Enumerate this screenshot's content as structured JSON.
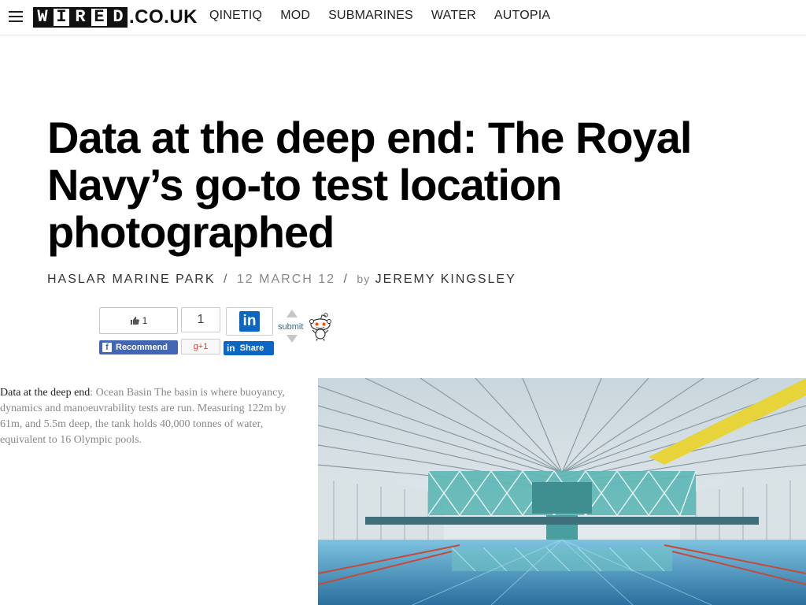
{
  "topnav": {
    "logo_letters": [
      "W",
      "I",
      "R",
      "E",
      "D"
    ],
    "logo_domain": ".CO.UK",
    "links": [
      "QINETIQ",
      "MOD",
      "SUBMARINES",
      "WATER",
      "AUTOPIA"
    ]
  },
  "article": {
    "headline": "Data at the deep end: The Royal Navy’s go-to test location photographed",
    "category": "HASLAR MARINE PARK",
    "date": "12 MARCH 12",
    "by_label": "by",
    "author": "JEREMY KINGSLEY"
  },
  "social": {
    "facebook_count": "1",
    "facebook_label": "Recommend",
    "google_count": "1",
    "google_label": "g+1",
    "linkedin_label": "Share",
    "reddit_label": "submit"
  },
  "caption": {
    "lead": "Data at the deep end",
    "text": ": Ocean Basin The basin is where buoyancy, dynamics and manoeuvrability tests are run. Measuring 122m by 61m, and 5.5m deep, the tank holds 40,000 tonnes of water, equivalent to 16 Olympic pools."
  },
  "colors": {
    "facebook": "#4267b2",
    "linkedin": "#0a66c2",
    "google": "#d14836",
    "frame_teal": "#5fb7b5",
    "frame_yellow": "#e7d33a"
  }
}
